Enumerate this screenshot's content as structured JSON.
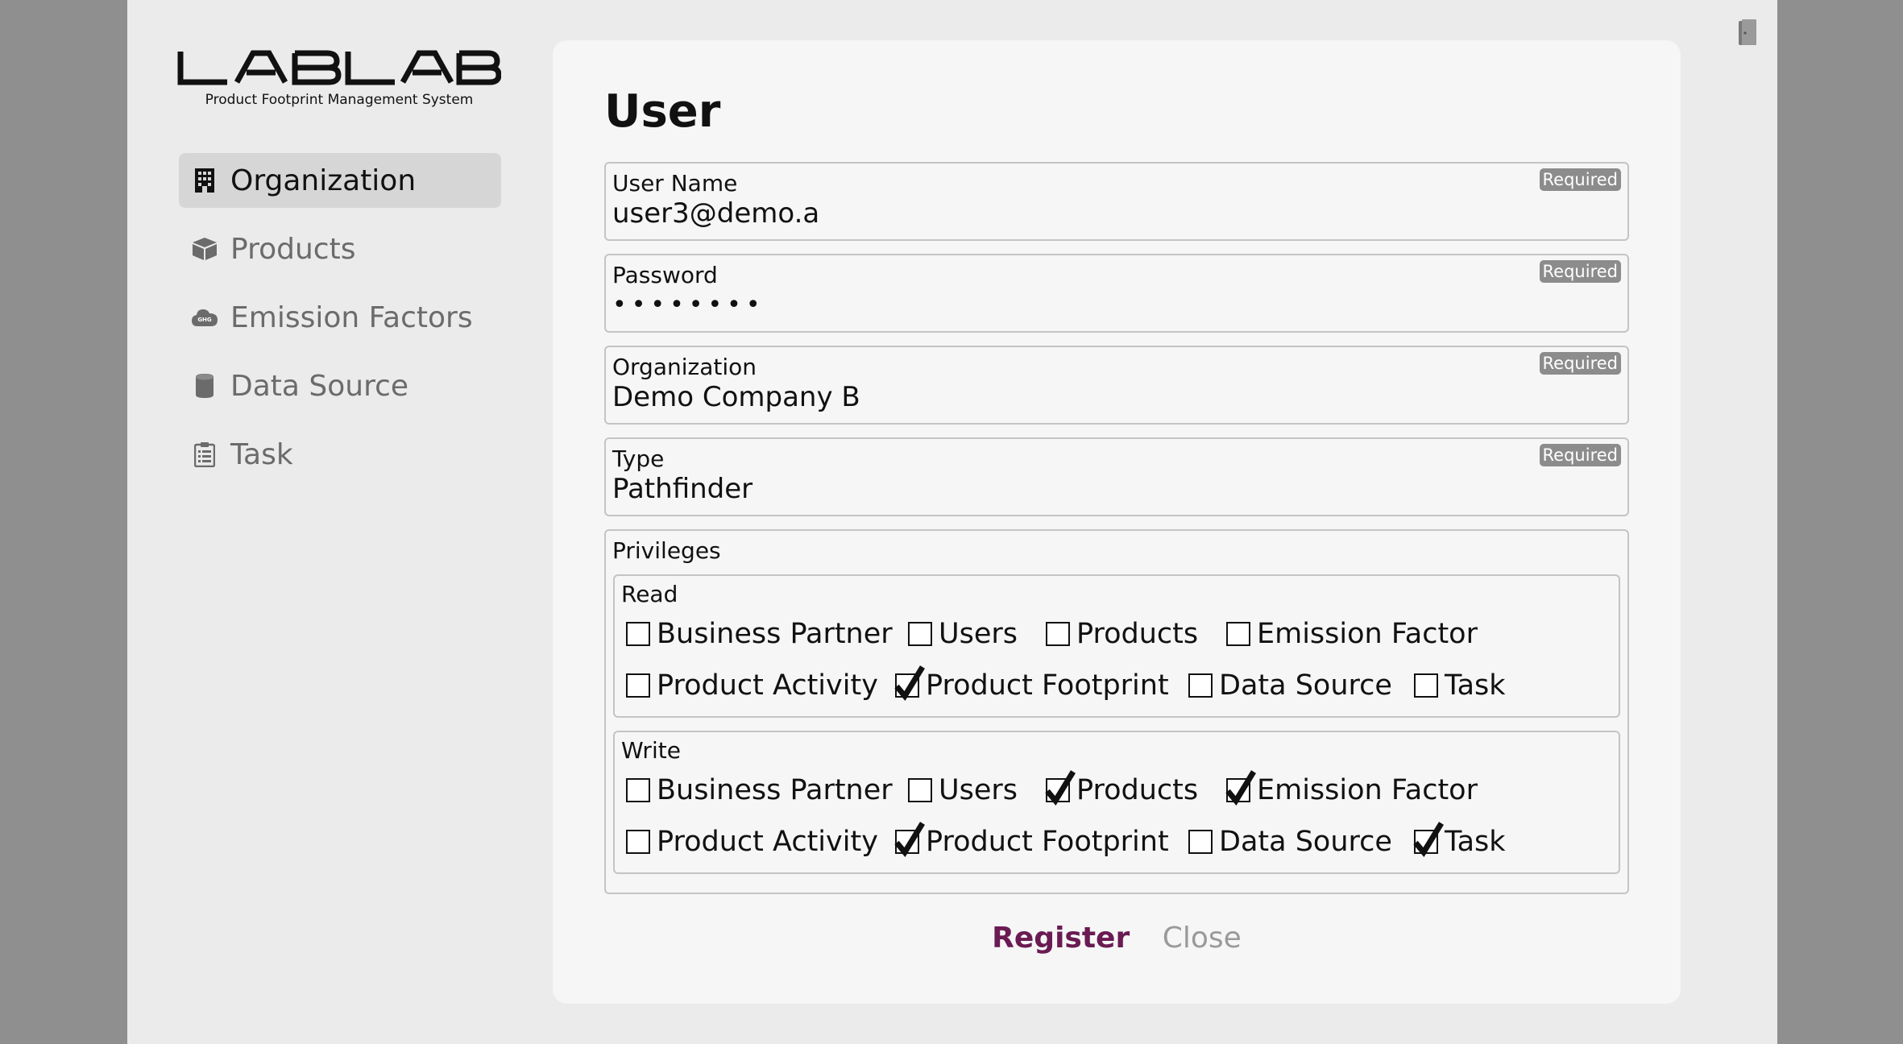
{
  "brand": {
    "logo_text": "LABLAB",
    "subtitle": "Product Footprint Management System"
  },
  "sidebar": {
    "items": [
      {
        "label": "Organization",
        "icon": "building-icon",
        "active": true
      },
      {
        "label": "Products",
        "icon": "box-icon",
        "active": false
      },
      {
        "label": "Emission Factors",
        "icon": "ghg-cloud-icon",
        "active": false
      },
      {
        "label": "Data Source",
        "icon": "database-icon",
        "active": false
      },
      {
        "label": "Task",
        "icon": "clipboard-icon",
        "active": false
      }
    ]
  },
  "form": {
    "title": "User",
    "required_badge": "Required",
    "fields": {
      "user_name": {
        "label": "User Name",
        "value": "user3@demo.a"
      },
      "password": {
        "label": "Password",
        "value": "••••••••"
      },
      "organization": {
        "label": "Organization",
        "value": "Demo Company B"
      },
      "type": {
        "label": "Type",
        "value": "Pathfinder"
      }
    },
    "privileges": {
      "label": "Privileges",
      "read": {
        "label": "Read",
        "items": [
          {
            "label": "Business Partner",
            "checked": false
          },
          {
            "label": "Users",
            "checked": false
          },
          {
            "label": "Products",
            "checked": false
          },
          {
            "label": "Emission Factor",
            "checked": false
          },
          {
            "label": "Product Activity",
            "checked": false
          },
          {
            "label": "Product Footprint",
            "checked": true
          },
          {
            "label": "Data Source",
            "checked": false
          },
          {
            "label": "Task",
            "checked": false
          }
        ]
      },
      "write": {
        "label": "Write",
        "items": [
          {
            "label": "Business Partner",
            "checked": false
          },
          {
            "label": "Users",
            "checked": false
          },
          {
            "label": "Products",
            "checked": true
          },
          {
            "label": "Emission Factor",
            "checked": true
          },
          {
            "label": "Product Activity",
            "checked": false
          },
          {
            "label": "Product Footprint",
            "checked": true
          },
          {
            "label": "Data Source",
            "checked": false
          },
          {
            "label": "Task",
            "checked": true
          }
        ]
      }
    },
    "actions": {
      "register": "Register",
      "close": "Close"
    }
  },
  "header": {
    "logout_icon": "door-icon"
  }
}
